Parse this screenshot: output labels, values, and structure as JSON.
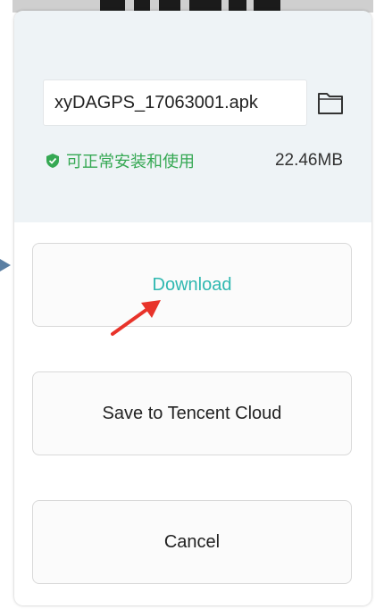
{
  "dialog": {
    "filename": "xyDAGPS_17063001.apk",
    "safe_label": "可正常安装和使用",
    "file_size": "22.46MB",
    "buttons": {
      "download": "Download",
      "save_tencent": "Save to Tencent Cloud",
      "cancel": "Cancel"
    }
  },
  "colors": {
    "accent": "#2fb8b0",
    "safe_green": "#35a853",
    "annotation_red": "#e8332a"
  },
  "icons": {
    "folder": "folder-icon",
    "shield": "shield-check-icon",
    "annotation_arrow": "red-arrow"
  }
}
